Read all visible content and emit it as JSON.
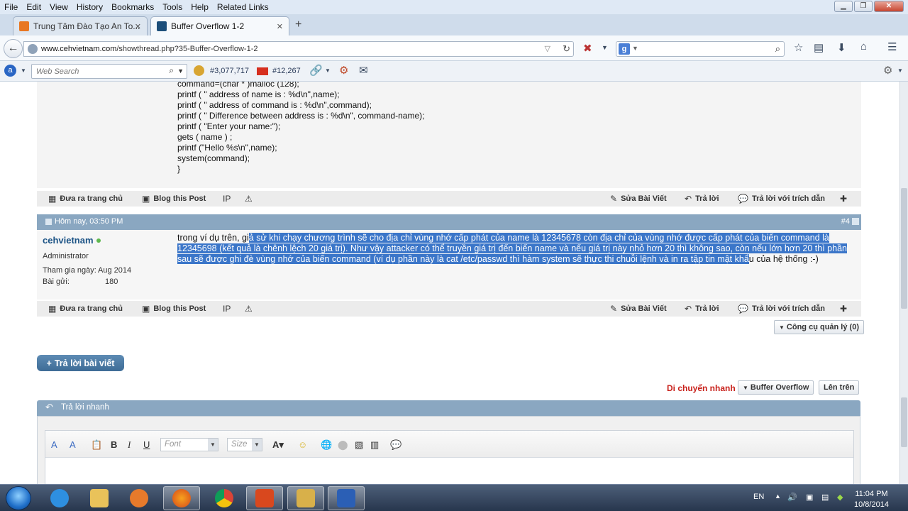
{
  "menubar": {
    "items": [
      "File",
      "Edit",
      "View",
      "History",
      "Bookmarks",
      "Tools",
      "Help",
      "Related Links"
    ]
  },
  "tabs": [
    {
      "title": "Trung Tâm Đào Tạo An To...",
      "active": false
    },
    {
      "title": "Buffer Overflow 1-2",
      "active": true
    }
  ],
  "url": {
    "domain": "www.cehvietnam.com",
    "path": "/showthread.php?35-Buffer-Overflow-1-2"
  },
  "addonbar": {
    "websearch_placeholder": "Web Search",
    "rank1": "#3,077,717",
    "rank2": "#12,267"
  },
  "code_lines": [
    "command=(char * )malloc (128);",
    "printf ( \" address of name is : %d\\n\",name);",
    "printf ( \" address of command is : %d\\n\",command);",
    "printf ( \" Difference between address is : %d\\n\", command-name);",
    "printf ( \"Enter your name:\");",
    "gets ( name ) ;",
    "printf (\"Hello %s\\n\",name);",
    "system(command);",
    "}"
  ],
  "post_footer": {
    "home": "Đưa ra trang chủ",
    "blog": "Blog this Post",
    "edit": "Sửa Bài Viết",
    "reply": "Trả lời",
    "quote": "Trả lời với trích dẫn"
  },
  "post4": {
    "datetime": "Hôm nay, 03:50 PM",
    "number": "#4",
    "username": "cehvietnam",
    "role": "Administrator",
    "join_label": "Tham gia ngày:",
    "join_value": "Aug 2014",
    "posts_label": "Bài gửi:",
    "posts_value": "180",
    "text_plain_start": "trong ví dụ trên, gi",
    "text_selected": "ả sử khi chạy chương trình sẽ cho địa chỉ vùng nhớ cấp phát của name là 12345678 còn địa chỉ của vùng nhớ được cấp phát của biến command là 12345698 (kết quả là chênh lệch 20 giá trị). Như vậy attacker có thể truyền giá trị đến biến name và nếu giá trị này nhỏ hơn 20 thì không sao, còn nếu lớn hơn 20 thì phần sau sẽ được ghi đè vùng nhớ của biến command (ví dụ phần này là cat /etc/passwd thì hàm system sẽ thực thi chuỗi lệnh và in ra tập tin mật khẩ",
    "text_plain_end": "u của hệ thống :-)"
  },
  "tools": {
    "admin_tools": "Công cụ quản lý (0)",
    "reply_thread": "Trả lời bài viết",
    "quick_nav": "Di chuyển nhanh",
    "forum_select": "Buffer Overflow",
    "top": "Lên trên"
  },
  "quick_reply": {
    "title": "Trả lời nhanh",
    "font_placeholder": "Font",
    "size_placeholder": "Size"
  },
  "taskbar": {
    "lang": "EN",
    "time": "11:04 PM",
    "date": "10/8/2014"
  }
}
